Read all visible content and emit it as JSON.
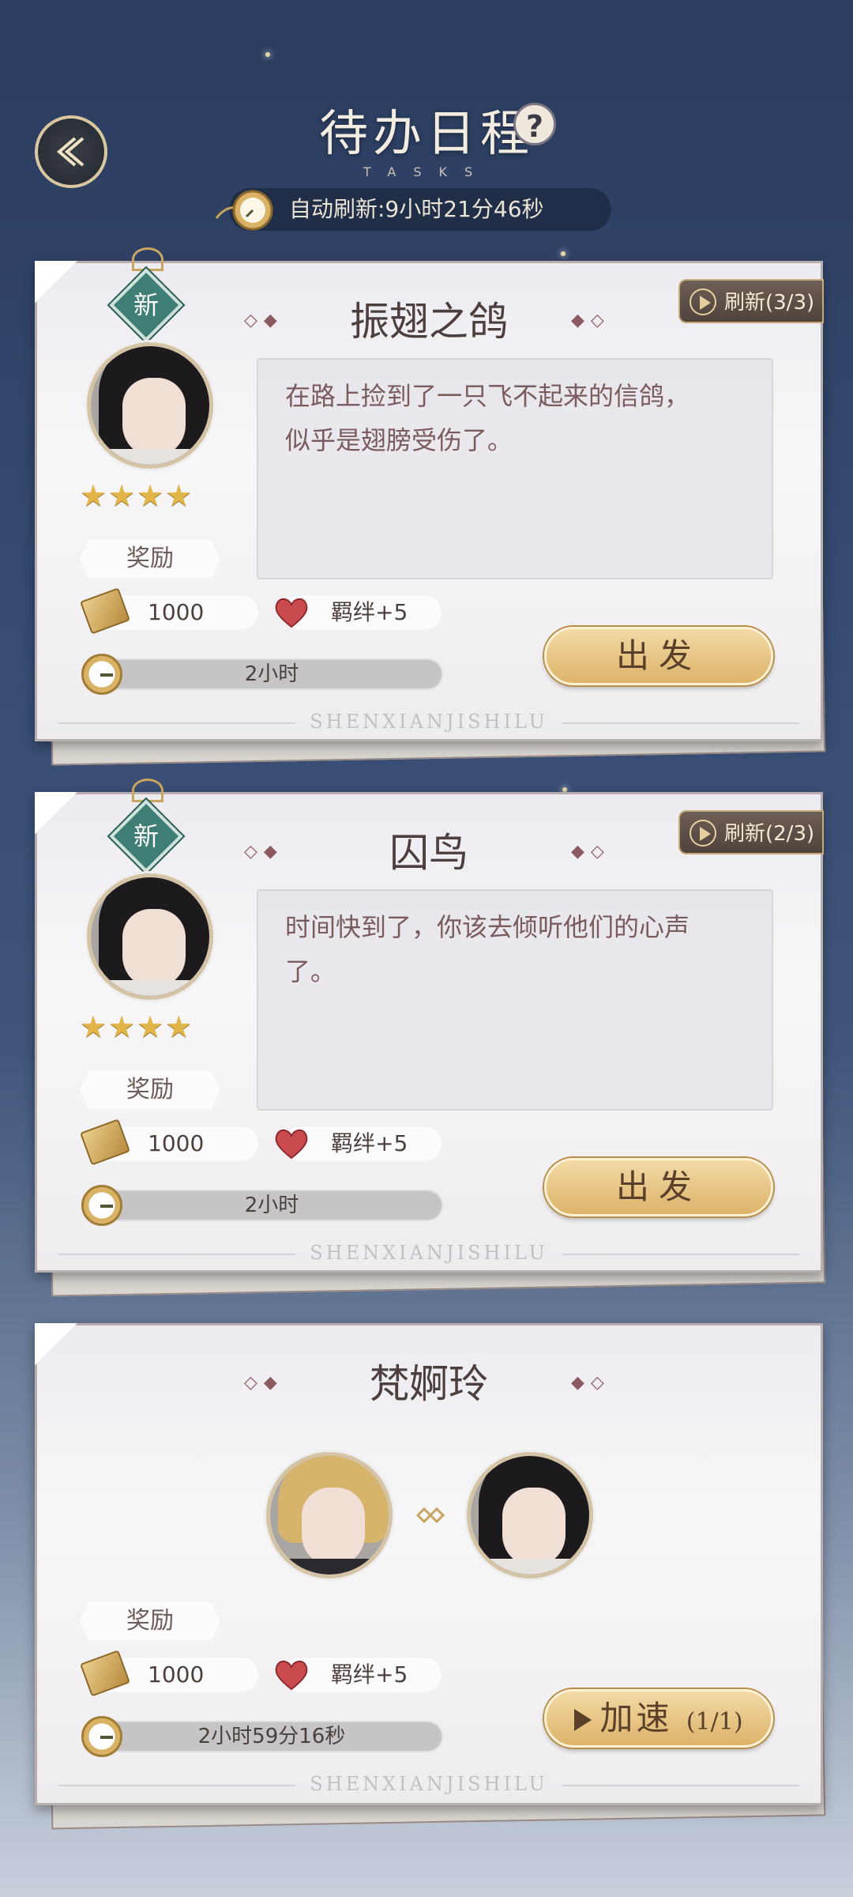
{
  "header": {
    "title": "待办日程",
    "subtitle": "TASKS",
    "help_symbol": "?",
    "refresh_text": "自动刷新:9小时21分46秒"
  },
  "tasks": [
    {
      "title": "振翅之鸽",
      "new_badge": "新",
      "refresh_label": "刷新(3/3)",
      "description_line1": "在路上捡到了一只飞不起来的信鸽，",
      "description_line2": "似乎是翅膀受伤了。",
      "stars": "★★★★",
      "reward_label": "奖励",
      "reward_ticket": "1000",
      "reward_bond": "羁绊+5",
      "time": "2小时",
      "action_label": "出发",
      "footer": "SHENXIANJISHILU"
    },
    {
      "title": "囚鸟",
      "new_badge": "新",
      "refresh_label": "刷新(2/3)",
      "description_line1": "时间快到了，你该去倾听他们的心声",
      "description_line2": "了。",
      "stars": "★★★★",
      "reward_label": "奖励",
      "reward_ticket": "1000",
      "reward_bond": "羁绊+5",
      "time": "2小时",
      "action_label": "出发",
      "footer": "SHENXIANJISHILU"
    },
    {
      "title": "梵婀玲",
      "reward_label": "奖励",
      "reward_ticket": "1000",
      "reward_bond": "羁绊+5",
      "time": "2小时59分16秒",
      "action_label": "加速",
      "action_count": "(1/1)",
      "footer": "SHENXIANJISHILU"
    }
  ],
  "colors": {
    "accent_gold": "#ddb36a",
    "badge_green": "#3f7e74",
    "bg_top": "#2b3c5e"
  },
  "icons": [
    "back-icon",
    "help-icon",
    "pocket-watch-icon",
    "play-icon",
    "ticket-icon",
    "heart-icon",
    "link-icon"
  ]
}
